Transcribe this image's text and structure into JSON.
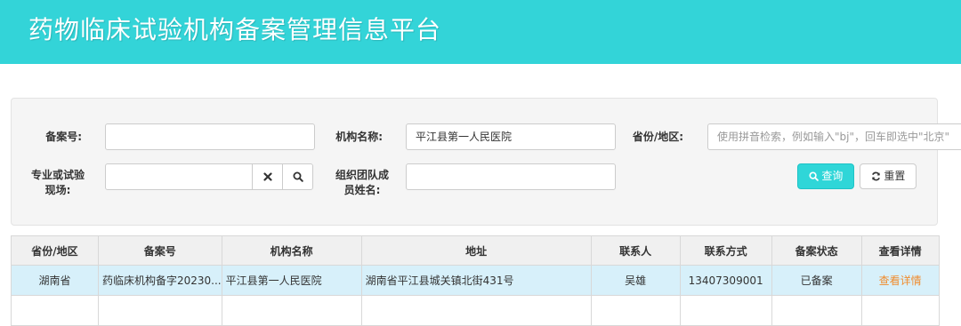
{
  "header": {
    "title": "药物临床试验机构备案管理信息平台"
  },
  "search": {
    "record_no_label": "备案号:",
    "record_no_value": "",
    "org_name_label": "机构名称:",
    "org_name_value": "平江县第一人民医院",
    "province_label": "省份/地区:",
    "province_placeholder": "使用拼音检索，例如输入\"bj\"，回车即选中\"北京\"",
    "specialty_label_line1": "专业或试验",
    "specialty_label_line2": "现场:",
    "specialty_value": "",
    "team_label_line1": "组织团队成",
    "team_label_line2": "员姓名:",
    "team_value": "",
    "clear_icon": "close-icon",
    "search_icon": "search-icon",
    "query_button": "查询",
    "reset_button": "重置"
  },
  "table": {
    "headers": [
      "省份/地区",
      "备案号",
      "机构名称",
      "地址",
      "联系人",
      "联系方式",
      "备案状态",
      "查看详情"
    ],
    "rows": [
      {
        "province": "湖南省",
        "record_no": "药临床机构备字20230...",
        "org_name": "平江县第一人民医院",
        "address": "湖南省平江县城关镇北街431号",
        "contact": "吴雄",
        "phone": "13407309001",
        "status": "已备案",
        "detail": "查看详情"
      }
    ]
  },
  "colors": {
    "header_bg": "#33d4d8",
    "primary": "#2fd6d8",
    "link": "#f08c2e",
    "row_highlight": "#d7f0fa"
  }
}
